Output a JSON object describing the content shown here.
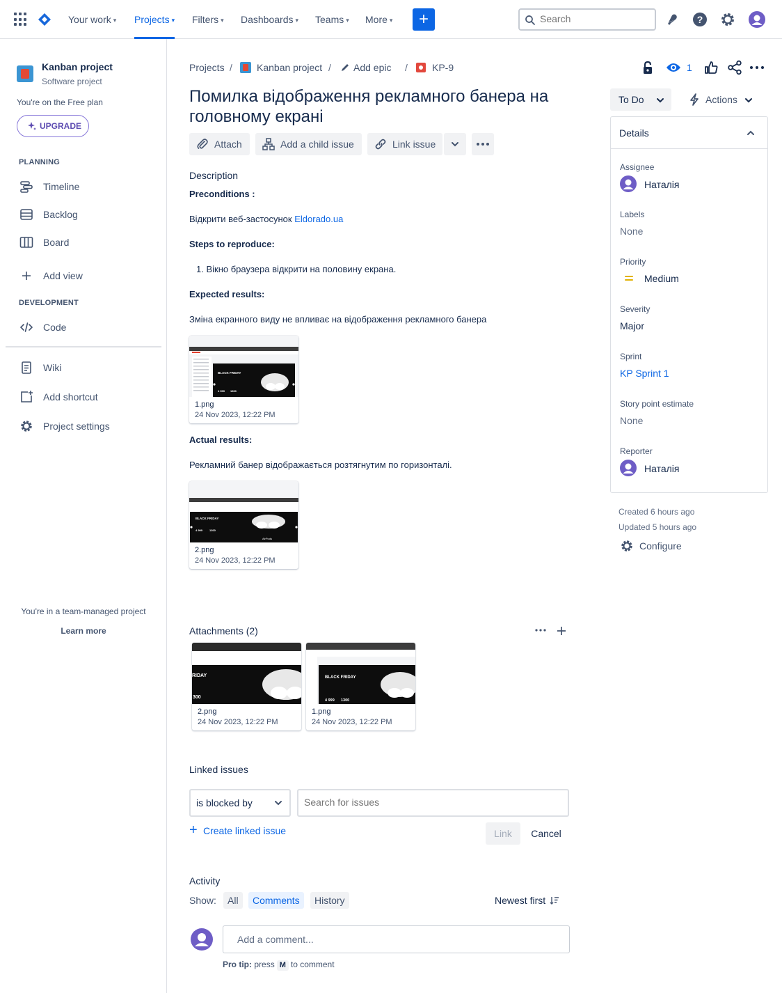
{
  "topnav": {
    "items": [
      {
        "label": "Your work"
      },
      {
        "label": "Projects"
      },
      {
        "label": "Filters"
      },
      {
        "label": "Dashboards"
      },
      {
        "label": "Teams"
      },
      {
        "label": "More"
      }
    ],
    "create_label": "+",
    "search_placeholder": "Search",
    "accent": "#0c66e4"
  },
  "sidebar": {
    "project_name": "Kanban project",
    "project_type": "Software project",
    "plan_text": "You're on the Free plan",
    "upgrade_label": "UPGRADE",
    "planning_heading": "PLANNING",
    "planning_items": [
      {
        "label": "Timeline",
        "icon": "timeline-icon"
      },
      {
        "label": "Backlog",
        "icon": "backlog-icon"
      },
      {
        "label": "Board",
        "icon": "board-icon"
      }
    ],
    "add_view": "Add view",
    "development_heading": "DEVELOPMENT",
    "code": "Code",
    "wiki": "Wiki",
    "add_shortcut": "Add shortcut",
    "project_settings": "Project settings",
    "team_managed": "You're in a team-managed project",
    "learn_more": "Learn more"
  },
  "breadcrumb": {
    "projects": "Projects",
    "project": "Kanban project",
    "add_epic": "Add epic",
    "issue_key": "KP-9"
  },
  "issue": {
    "title": "Помилка відображення рекламного банера на головному екрані",
    "toolbar": {
      "attach": "Attach",
      "add_child": "Add a child issue",
      "link_issue": "Link issue"
    },
    "watchers": "1"
  },
  "description": {
    "label": "Description",
    "preconditions_heading": "Preconditions :",
    "preconditions_text": "Відкрити веб-застосунок ",
    "preconditions_link": "Eldorado.ua",
    "steps_heading": "Steps to reproduce:",
    "steps": [
      "1. Вікно браузера відкрити на половину екрана."
    ],
    "expected_heading": "Expected results:",
    "expected_text": "Зміна екранного виду не впливає на відображення рекламного банера",
    "expected_attachment": {
      "name": "1.png",
      "date": "24 Nov 2023, 12:22 PM"
    },
    "actual_heading": "Actual results:",
    "actual_text": "Рекламний банер відображається розтягнутим по горизонталі.",
    "actual_attachment": {
      "name": "2.png",
      "date": "24 Nov 2023, 12:22 PM"
    }
  },
  "thumb_text": {
    "black_friday": "BLACK FRIDAY",
    "black_friday_cropped": "RIDAY",
    "price_1": "4 999",
    "price_2": "1300",
    "price_cropped": "300",
    "brand": "AirPods"
  },
  "attachments": {
    "title": "Attachments (2)",
    "items": [
      {
        "name": "2.png",
        "date": "24 Nov 2023, 12:22 PM"
      },
      {
        "name": "1.png",
        "date": "24 Nov 2023, 12:22 PM"
      }
    ]
  },
  "linked_issues": {
    "title": "Linked issues",
    "relation": "is blocked by",
    "search_placeholder": "Search for issues",
    "create_label": "Create linked issue",
    "link_label": "Link",
    "cancel_label": "Cancel"
  },
  "activity": {
    "title": "Activity",
    "show_label": "Show:",
    "filters": [
      "All",
      "Comments",
      "History"
    ],
    "active_filter": "Comments",
    "sort_label": "Newest first",
    "comment_placeholder": "Add a comment...",
    "pro_tip_prefix": "Pro tip:",
    "pro_tip_press": "press",
    "pro_tip_key": "M",
    "pro_tip_suffix": "to comment"
  },
  "right_panel": {
    "status": "To Do",
    "actions": "Actions",
    "details_title": "Details",
    "fields": {
      "assignee_label": "Assignee",
      "assignee_value": "Наталія",
      "labels_label": "Labels",
      "labels_value": "None",
      "priority_label": "Priority",
      "priority_value": "Medium",
      "severity_label": "Severity",
      "severity_value": "Major",
      "sprint_label": "Sprint",
      "sprint_value": "KP Sprint 1",
      "story_label": "Story point estimate",
      "story_value": "None",
      "reporter_label": "Reporter",
      "reporter_value": "Наталія"
    },
    "created": "Created 6 hours ago",
    "updated": "Updated 5 hours ago",
    "configure": "Configure"
  }
}
